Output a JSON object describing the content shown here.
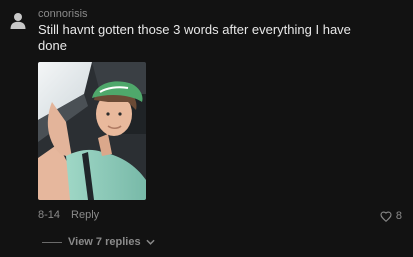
{
  "comment": {
    "username": "connorisis",
    "text": "Still havnt gotten those 3 words after everything I have done",
    "date": "8-14",
    "reply_label": "Reply",
    "likes": "8",
    "view_replies_label": "View 7 replies"
  },
  "colors": {
    "background": "#121212",
    "text_primary": "#e8e8e8",
    "text_secondary": "#8a8a8a"
  },
  "icons": [
    "default-avatar-icon",
    "heart-icon",
    "chevron-down-icon"
  ]
}
